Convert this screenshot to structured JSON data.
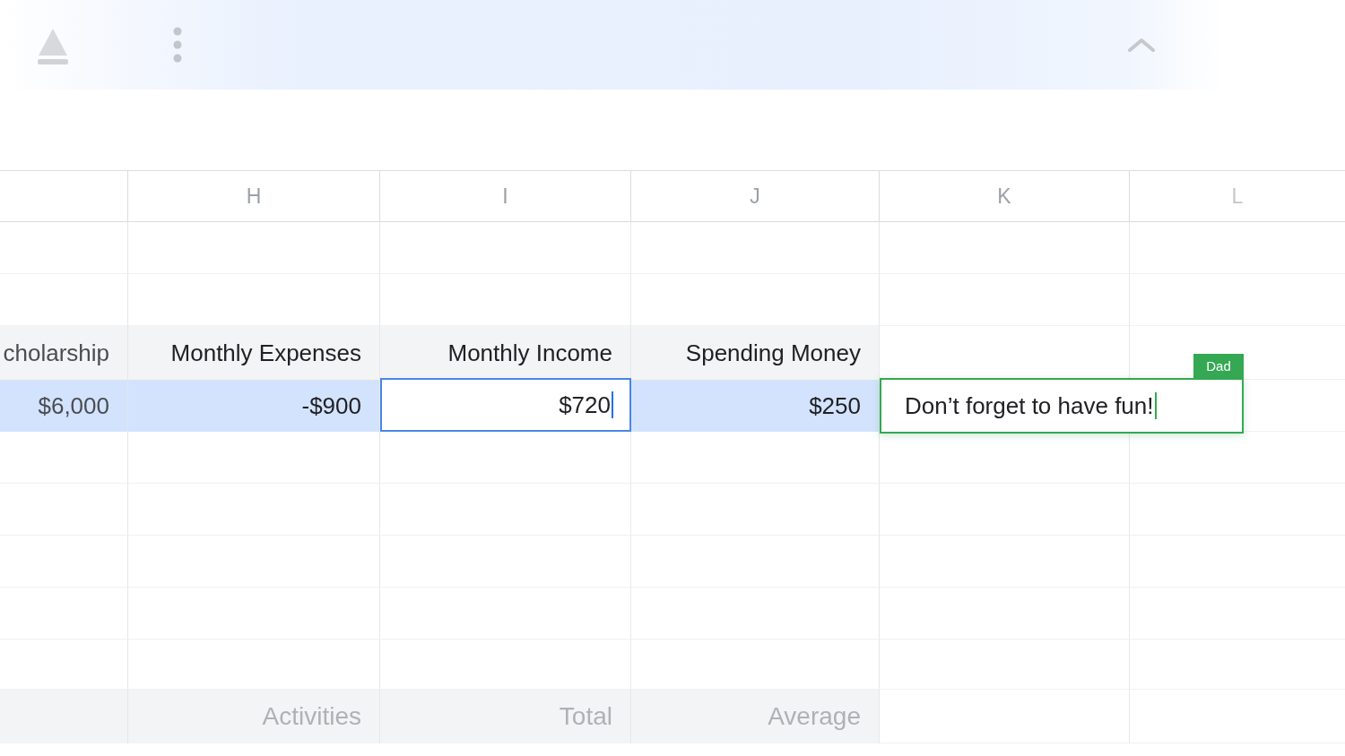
{
  "column_letters": [
    "H",
    "I",
    "J",
    "K",
    "L"
  ],
  "label_row": {
    "cells": [
      "cholarship",
      "Monthly Expenses",
      "Monthly Income",
      "Spending Money"
    ]
  },
  "value_row": {
    "selected": true,
    "cells": [
      {
        "text": "$6,000",
        "editing": false
      },
      {
        "text": "-$900",
        "editing": false
      },
      {
        "text": "$720",
        "editing": true
      },
      {
        "text": "$250",
        "editing": false
      }
    ]
  },
  "collaborator_cell": {
    "text": "Don’t forget to have fun!",
    "author": "Dad"
  },
  "summary_row": {
    "cells": [
      "Activities",
      "Total",
      "Average"
    ]
  }
}
